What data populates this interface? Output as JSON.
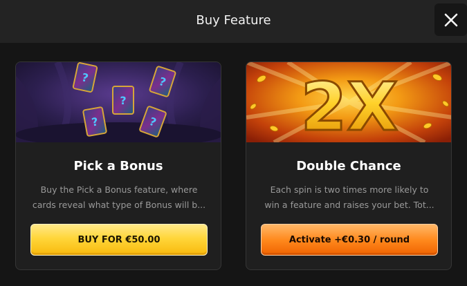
{
  "header": {
    "title": "Buy Feature",
    "close_icon": "close-icon"
  },
  "cards": [
    {
      "title": "Pick a Bonus",
      "description_lines": [
        "Buy the Pick a Bonus feature, where",
        "cards reveal what type of Bonus will b..."
      ],
      "button_label": "BUY FOR €50.00",
      "image_icon": "mystery-cards-icon"
    },
    {
      "title": "Double Chance",
      "description_lines": [
        "Each spin is two times more likely to",
        "win a feature and raises your bet. Tot..."
      ],
      "button_label": "Activate +€0.30 / round",
      "image_text": "2X",
      "image_icon": "2x-multiplier-icon"
    }
  ],
  "colors": {
    "background": "#151515",
    "header": "#232323",
    "card": "#1f1f1f",
    "buy_button": "#ffd63a",
    "activate_button": "#ff8a1e",
    "description_text": "#9a9a9a"
  }
}
